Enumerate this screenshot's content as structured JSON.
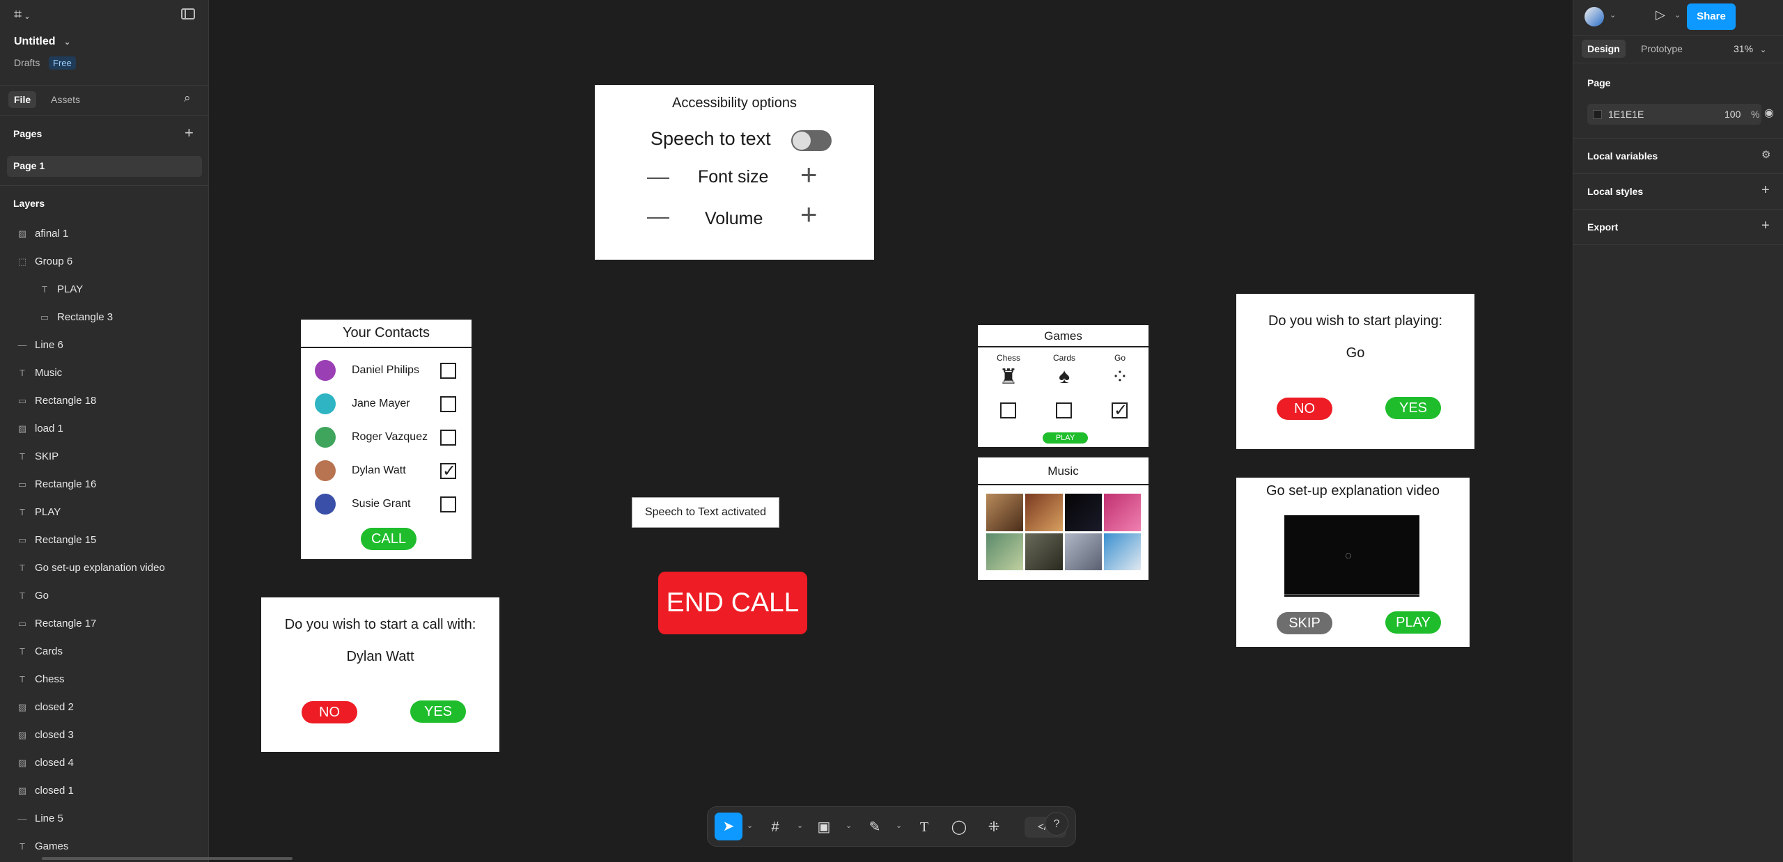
{
  "left_panel": {
    "file_name": "Untitled",
    "location": "Drafts",
    "plan_badge": "Free",
    "tabs": [
      "File",
      "Assets"
    ],
    "pages_heading": "Pages",
    "pages": [
      "Page 1"
    ],
    "layers_heading": "Layers",
    "layers": [
      {
        "icon": "image-icon",
        "label": "afinal 1"
      },
      {
        "icon": "frame-icon",
        "label": "Group 6"
      },
      {
        "icon": "text-icon",
        "label": "PLAY"
      },
      {
        "icon": "rectangle-icon",
        "label": "Rectangle 3"
      },
      {
        "icon": "line-icon",
        "label": "Line 6"
      },
      {
        "icon": "text-icon",
        "label": "Music"
      },
      {
        "icon": "rectangle-icon",
        "label": "Rectangle 18"
      },
      {
        "icon": "image-icon",
        "label": "load 1"
      },
      {
        "icon": "text-icon",
        "label": "SKIP"
      },
      {
        "icon": "rectangle-icon",
        "label": "Rectangle 16"
      },
      {
        "icon": "text-icon",
        "label": "PLAY"
      },
      {
        "icon": "rectangle-icon",
        "label": "Rectangle 15"
      },
      {
        "icon": "text-icon",
        "label": "Go set-up explanation video"
      },
      {
        "icon": "text-icon",
        "label": "Go"
      },
      {
        "icon": "rectangle-icon",
        "label": "Rectangle 17"
      },
      {
        "icon": "text-icon",
        "label": "Cards"
      },
      {
        "icon": "text-icon",
        "label": "Chess"
      },
      {
        "icon": "image-icon",
        "label": "closed 2"
      },
      {
        "icon": "image-icon",
        "label": "closed 3"
      },
      {
        "icon": "image-icon",
        "label": "closed 4"
      },
      {
        "icon": "image-icon",
        "label": "closed 1"
      },
      {
        "icon": "line-icon",
        "label": "Line 5"
      },
      {
        "icon": "text-icon",
        "label": "Games"
      }
    ]
  },
  "right_panel": {
    "tabs": [
      "Design",
      "Prototype"
    ],
    "zoom": "31%",
    "share_label": "Share",
    "page_heading": "Page",
    "page_color": "1E1E1E",
    "page_opacity": "100",
    "percent": "%",
    "sections": [
      "Local variables",
      "Local styles",
      "Export"
    ]
  },
  "canvas": {
    "accessibility": {
      "title": "Accessibility options",
      "speech": "Speech to text",
      "font_size": "Font size",
      "volume": "Volume",
      "minus": "—",
      "plus": "+"
    },
    "contacts": {
      "title": "Your Contacts",
      "people": [
        {
          "name": "Daniel Philips",
          "color": "#9b3fb5",
          "checked": false
        },
        {
          "name": "Jane Mayer",
          "color": "#2eb4c2",
          "checked": false
        },
        {
          "name": "Roger Vazquez",
          "color": "#3fa45c",
          "checked": false
        },
        {
          "name": "Dylan Watt",
          "color": "#b87350",
          "checked": true
        },
        {
          "name": "Susie Grant",
          "color": "#3a4fa8",
          "checked": false
        }
      ],
      "call": "CALL"
    },
    "call_confirm": {
      "question": "Do you wish to start a call with:",
      "name": "Dylan Watt",
      "no": "NO",
      "yes": "YES"
    },
    "speech_toast": "Speech to Text activated",
    "end_call": "END CALL",
    "games": {
      "title": "Games",
      "items": [
        {
          "name": "Chess",
          "icon": "chess-rook-icon",
          "glyph": "♜",
          "checked": false
        },
        {
          "name": "Cards",
          "icon": "playing-cards-icon",
          "glyph": "♠",
          "checked": false
        },
        {
          "name": "Go",
          "icon": "go-stones-icon",
          "glyph": "⁘",
          "checked": true
        }
      ],
      "play": "PLAY"
    },
    "music": {
      "title": "Music"
    },
    "play_confirm": {
      "question": "Do you wish to start playing:",
      "game": "Go",
      "no": "NO",
      "yes": "YES"
    },
    "video": {
      "title": "Go set-up explanation video",
      "skip": "SKIP",
      "play": "PLAY"
    }
  },
  "colors": {
    "accent": "#0d99ff",
    "red": "#ee1c24",
    "green": "#1fbd2c",
    "grey": "#6e6e6e"
  }
}
